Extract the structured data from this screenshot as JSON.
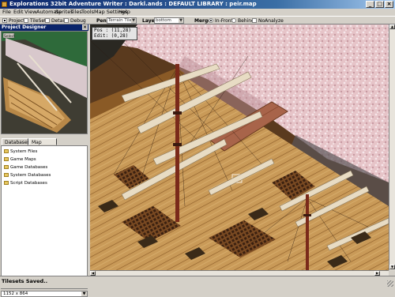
{
  "window": {
    "title": "Explorations 32bit Adventure Writer : Darkl.ands : DEFAULT LIBRARY : peir.map",
    "min": "_",
    "max": "□",
    "close": "×"
  },
  "menu": [
    "File",
    "Edit",
    "View",
    "Automate",
    "Sprites",
    "Tiles",
    "Tools",
    "Map Settings",
    "Help"
  ],
  "toolbar": {
    "project_label": "Project",
    "tileset_label": "TileSet",
    "detail_label": "Detail",
    "debug_label": "Debug",
    "pen_label": "Pen:",
    "pen_value": "Terrain Tile",
    "layer_label": "Layer:",
    "layer_value": "bottom",
    "merge_label": "Merge:",
    "infront_label": "In-Front",
    "behind_label": "Behind",
    "noanalyze_label": "NoAnalyze"
  },
  "project_designer": {
    "title": "Project Designer",
    "close": "×",
    "preview_label": "Select"
  },
  "tabs": [
    "Databases",
    "Map Objects"
  ],
  "tree_items": [
    "System Files",
    "Game Maps",
    "Game Databases",
    "System Databases",
    "Script Databases"
  ],
  "resolution": "1152 x 864",
  "coords": {
    "line1": "Pos : (11,28)",
    "line2": "Edit: (0,28)"
  },
  "status": "Tilesets Saved..",
  "colors": {
    "titlebar": "#0a246a",
    "chrome": "#d4d0c8",
    "deck": "#c99a58",
    "blossom": "#e8c8cc"
  }
}
